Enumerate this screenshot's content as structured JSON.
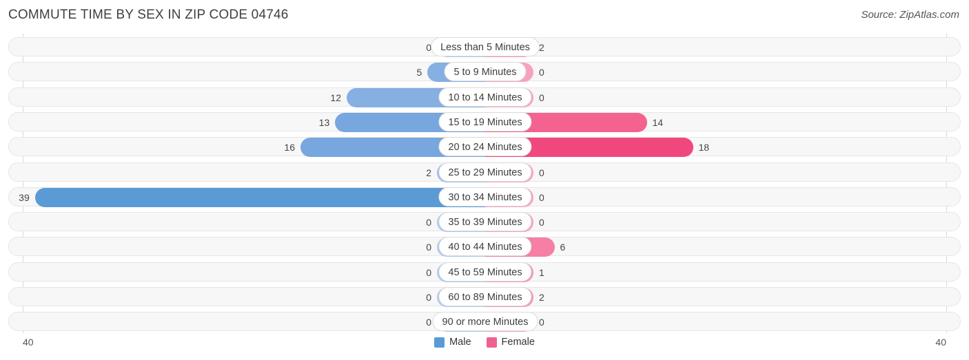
{
  "header": {
    "title": "COMMUTE TIME BY SEX IN ZIP CODE 04746",
    "source": "Source: ZipAtlas.com"
  },
  "legend": {
    "male_label": "Male",
    "female_label": "Female",
    "male_color": "#5B9BD5",
    "female_color": "#F0608F"
  },
  "axis": {
    "left_label": "40",
    "right_label": "40"
  },
  "chart_data": {
    "type": "bar",
    "title": "COMMUTE TIME BY SEX IN ZIP CODE 04746",
    "subtitle": "Source: ZipAtlas.com",
    "orientation": "horizontal-diverging",
    "xlabel": "",
    "ylabel": "",
    "xlim": [
      40,
      40
    ],
    "axis_max": 40,
    "grid": false,
    "legend_position": "bottom-center",
    "categories": [
      "Less than 5 Minutes",
      "5 to 9 Minutes",
      "10 to 14 Minutes",
      "15 to 19 Minutes",
      "20 to 24 Minutes",
      "25 to 29 Minutes",
      "30 to 34 Minutes",
      "35 to 39 Minutes",
      "40 to 44 Minutes",
      "45 to 59 Minutes",
      "60 to 89 Minutes",
      "90 or more Minutes"
    ],
    "series": [
      {
        "name": "Male",
        "color": "#5B9BD5",
        "side": "left",
        "values": [
          0,
          5,
          12,
          13,
          16,
          2,
          39,
          0,
          0,
          0,
          0,
          0
        ]
      },
      {
        "name": "Female",
        "color": "#F0608F",
        "side": "right",
        "values": [
          2,
          0,
          0,
          14,
          18,
          0,
          0,
          0,
          6,
          1,
          2,
          0
        ]
      }
    ]
  }
}
